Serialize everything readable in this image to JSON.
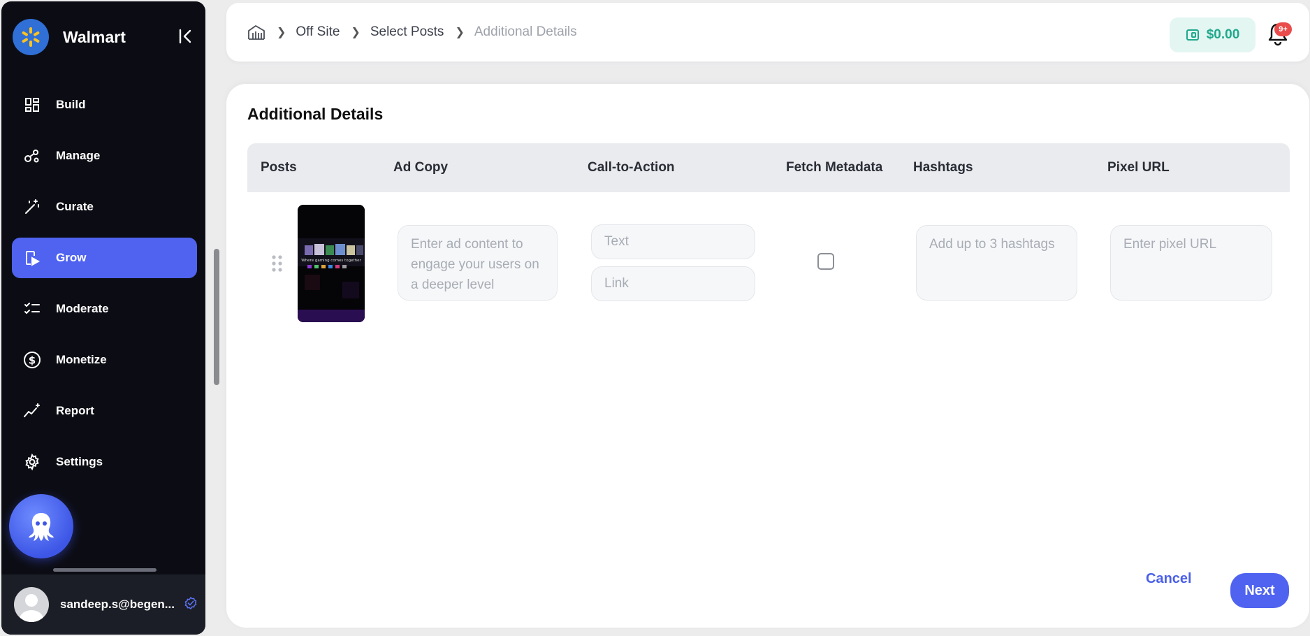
{
  "sidebar": {
    "brand_name": "Walmart",
    "items": [
      {
        "label": "Build",
        "icon": "grid-icon"
      },
      {
        "label": "Manage",
        "icon": "nodes-icon"
      },
      {
        "label": "Curate",
        "icon": "magic-wand-icon"
      },
      {
        "label": "Grow",
        "icon": "play-screen-icon",
        "active": true
      },
      {
        "label": "Moderate",
        "icon": "checklist-icon"
      },
      {
        "label": "Monetize",
        "icon": "dollar-circle-icon"
      },
      {
        "label": "Report",
        "icon": "trend-sparkle-icon"
      },
      {
        "label": "Settings",
        "icon": "gear-icon"
      }
    ],
    "user_email": "sandeep.s@begen...",
    "colors": {
      "background": "#0c0d14",
      "active": "#4f63f0"
    }
  },
  "header": {
    "breadcrumb": [
      "Off Site",
      "Select Posts",
      "Additional Details"
    ],
    "wallet_amount": "$0.00",
    "notification_badge": "9+"
  },
  "main": {
    "title": "Additional Details",
    "columns": [
      "Posts",
      "Ad Copy",
      "Call-to-Action",
      "Fetch Metadata",
      "Hashtags",
      "Pixel URL"
    ],
    "row": {
      "post_thumb_caption": "Where gaming comes together",
      "ad_copy_placeholder": "Enter ad content to engage your users on a deeper level",
      "cta_text_placeholder": "Text",
      "cta_link_placeholder": "Link",
      "hashtags_placeholder": "Add up to 3 hashtags",
      "pixel_url_placeholder": "Enter pixel URL",
      "fetch_metadata": false
    },
    "actions": {
      "cancel": "Cancel",
      "next": "Next"
    }
  }
}
